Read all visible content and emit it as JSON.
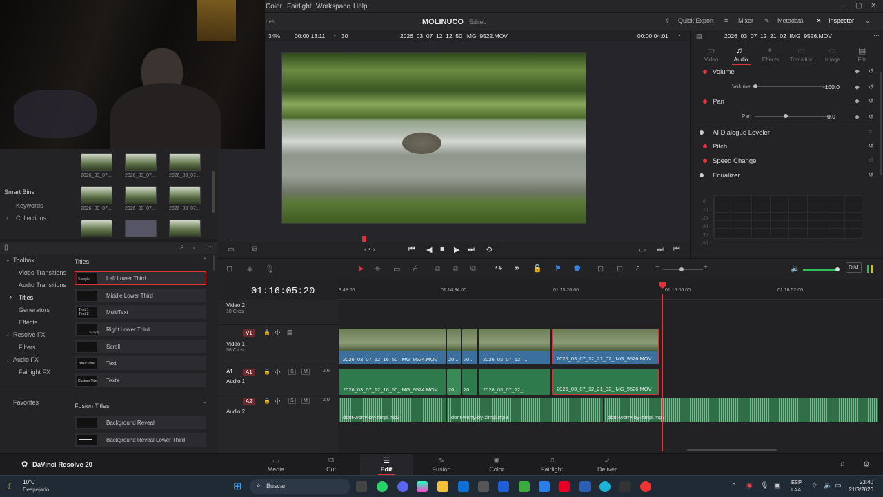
{
  "menu": {
    "items": [
      "Color",
      "Fairlight",
      "Workspace",
      "Help"
    ]
  },
  "header": {
    "project": "MOLINUCO",
    "status": "Edited",
    "quick_export": "Quick Export",
    "mixer": "Mixer",
    "metadata": "Metadata",
    "inspector": "Inspector"
  },
  "viewer": {
    "zoom": "34%",
    "timecode_left": "00:00:13:11",
    "fps": "30",
    "clip_name": "2026_03_07_12_12_50_IMG_9522.MOV",
    "timecode_right": "00:00:04:01"
  },
  "inspector": {
    "clip_name": "2026_03_07_12_21_02_IMG_9526.MOV",
    "tabs": [
      "Video",
      "Audio",
      "Effects",
      "Transition",
      "Image",
      "File"
    ],
    "volume_label": "Volume",
    "volume_param": "Volume",
    "volume_value": "-100.0",
    "pan_label": "Pan",
    "pan_param": "Pan",
    "pan_value": "0.0",
    "ai_dialogue": "AI Dialogue Leveler",
    "pitch": "Pitch",
    "speed_change": "Speed Change",
    "equalizer": "Equalizer",
    "eq_ticks": [
      "0",
      "-10",
      "-20",
      "-30",
      "-40",
      "-50"
    ]
  },
  "media": {
    "truncated": "nes",
    "thumb_caption": "2026_03_07..."
  },
  "bins": {
    "smart_bins": "Smart Bins",
    "keywords": "Keywords",
    "collections": "Collections"
  },
  "toolbox": {
    "items": [
      "Toolbox",
      "Video Transitions",
      "Audio Transitions",
      "Titles",
      "Generators",
      "Effects",
      "Resolve FX",
      "Filters",
      "Audio FX",
      "Fairlight FX",
      "Favorites"
    ]
  },
  "titles": {
    "heading": "Titles",
    "items": [
      "Left Lower Third",
      "Middle Lower Third",
      "MultiText",
      "Right Lower Third",
      "Scroll",
      "Text",
      "Text+"
    ],
    "icon_labels": [
      "Sample",
      "",
      "Text 1 Text 2",
      "Sample",
      "",
      "Basic Title",
      "Custom Title"
    ],
    "fusion_heading": "Fusion Titles",
    "fusion_items": [
      "Background Reveal",
      "Background Reveal Lower Third"
    ]
  },
  "timeline": {
    "timecode": "01:16:05:20",
    "ruler": [
      "3:48:00",
      "01:14:34:00",
      "01:15:20:00",
      "01:16:06:00",
      "01:16:52:00"
    ],
    "dim": "DIM",
    "tracks": [
      {
        "name": "Video 2",
        "sub": "10 Clips"
      },
      {
        "id": "V1",
        "name": "Video 1",
        "sub": "96 Clips"
      },
      {
        "id": "A1",
        "name": "Audio 1",
        "vol": "2.0"
      },
      {
        "id": "A2",
        "name": "Audio 2",
        "vol": "2.0"
      }
    ],
    "v1_clips": [
      "2026_03_07_12_16_50_IMG_9524.MOV",
      "20...",
      "20...",
      "2026_03_07_12_...",
      "2026_03_07_12_21_02_IMG_9526.MOV"
    ],
    "a1_clips": [
      "2026_03_07_12_16_50_IMG_9524.MOV",
      "20...",
      "20...",
      "2026_03_07_12_...",
      "2026_03_07_12_21_02_IMG_9526.MOV"
    ],
    "a2_clips": [
      "dont-worry-by-zimpl.mp3",
      "dont-worry-by-zimpl.mp3",
      "dont-worry-by-zimpl.mp3"
    ]
  },
  "pages": [
    "Media",
    "Cut",
    "Edit",
    "Fusion",
    "Color",
    "Fairlight",
    "Deliver"
  ],
  "app": {
    "name": "DaVinci Resolve 20"
  },
  "taskbar": {
    "temp": "10°C",
    "weather": "Despejado",
    "search": "Buscar",
    "lang1": "ESP",
    "lang2": "LAA",
    "time": "23:40",
    "date": "21/3/2026"
  },
  "colors": {
    "accent_red": "#e0333a",
    "selected_clip": "#d33a3a",
    "playhead": "#e0333a"
  }
}
